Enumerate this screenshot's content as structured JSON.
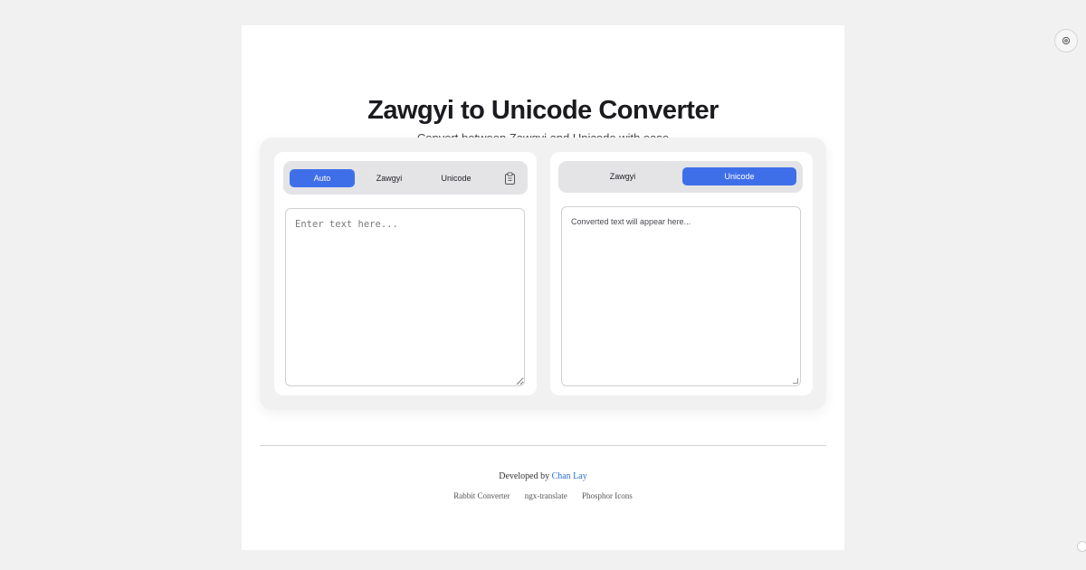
{
  "header": {
    "title": "Zawgyi to Unicode Converter",
    "subtitle": "Convert between Zawgyi and Unicode with ease"
  },
  "input_panel": {
    "modes": [
      "Auto",
      "Zawgyi",
      "Unicode"
    ],
    "active_mode": "Auto",
    "paste_icon": "clipboard-icon",
    "placeholder": "Enter text here...",
    "value": ""
  },
  "output_panel": {
    "modes": [
      "Zawgyi",
      "Unicode"
    ],
    "active_mode": "Unicode",
    "placeholder": "Converted text will appear here..."
  },
  "footer": {
    "developed_by": "Developed by",
    "author": "Chan Lay",
    "links": [
      "Rabbit Converter",
      "ngx-translate",
      "Phosphor Icons"
    ]
  },
  "settings_icon": "settings-icon",
  "colors": {
    "accent": "#3f6fe8",
    "background": "#f1f1f2",
    "link": "#2b6fd6"
  }
}
